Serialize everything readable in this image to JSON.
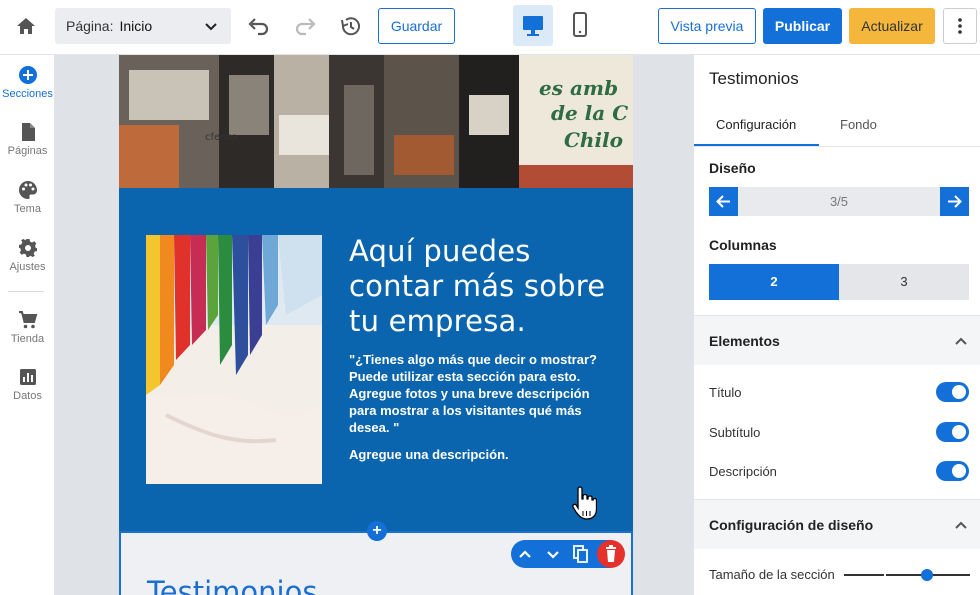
{
  "topbar": {
    "page_label": "Página:",
    "page_value": "Inicio",
    "save_label": "Guardar",
    "preview_label": "Vista previa",
    "publish_label": "Publicar",
    "update_label": "Actualizar"
  },
  "sidebar": {
    "items": [
      {
        "label": "Secciones",
        "icon": "plus-circle-icon"
      },
      {
        "label": "Páginas",
        "icon": "page-icon"
      },
      {
        "label": "Tema",
        "icon": "palette-icon"
      },
      {
        "label": "Ajustes",
        "icon": "gear-icon"
      },
      {
        "label": "Tienda",
        "icon": "cart-icon"
      },
      {
        "label": "Datos",
        "icon": "chart-icon"
      }
    ]
  },
  "canvas": {
    "about_title": "Aquí puedes contar más sobre tu empresa.",
    "about_quote": "\"¿Tienes algo más que decir o mostrar? Puede utilizar esta sección para esto. Agregue fotos y una breve descripción para mostrar a los visitantes qué más desea. \"",
    "about_desc": "Agregue una descripción.",
    "testimonials_title": "Testimonios",
    "photo_text_1": "es amb",
    "photo_text_2": "de la C",
    "photo_text_3": "Chilo"
  },
  "panel": {
    "title": "Testimonios",
    "tabs": [
      "Configuración",
      "Fondo"
    ],
    "design_label": "Diseño",
    "design_value": "3/5",
    "columns_label": "Columnas",
    "columns_options": [
      "2",
      "3"
    ],
    "elements_label": "Elementos",
    "toggles": [
      "Título",
      "Subtítulo",
      "Descripción"
    ],
    "layout_label": "Configuración de diseño",
    "size_label": "Tamaño de la sección"
  },
  "colors": {
    "accent": "#1370d8",
    "update": "#f4b73c",
    "about_bg": "#0a64ae",
    "delete": "#e4312c"
  }
}
